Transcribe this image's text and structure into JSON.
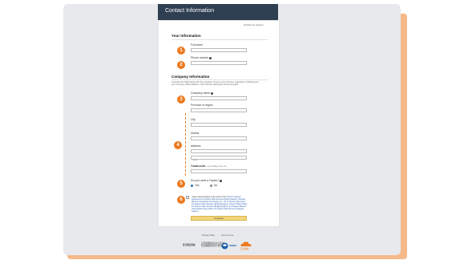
{
  "header": {
    "title": "Contact Information"
  },
  "form": {
    "required_note": "All fields are required",
    "your_info_title": "Your Information",
    "full_name_label": "Full name",
    "phone_label": "Phone number",
    "company_title": "Company Information",
    "company_desc": "Complete the fields below with the company name as your business registration certificate and your company official address. Only Chinese addresses will be accepted.",
    "company_name_label": "Company name",
    "province_label": "Province or region",
    "city_label": "City",
    "district_label": "District",
    "address_label": "Address",
    "address_placeholder": "Street",
    "address2_placeholder": "Apartment, suite, unit, building, floor, etc.",
    "postal_label": "Postal code",
    "fapiao_question": "Do you need a Fapiao?",
    "yes_label": "Yes",
    "no_label": "No",
    "agree_prefix": "I have read and agree to the terms of the",
    "agree_links": "Sinnet Customer Agreement for Amazon Web Services (Beijing Region), Ningxia Western Cloud Data Technology Co., Ltd. Customer Agreement for Amazon Web Services (Ningxia Region), Sinnet Privacy Policy for Amazon Web Services (Beijing Region), and Ningxia Western Cloud Data Privacy Policy for Amazon Web Services (Ningxia Region).",
    "continue_button": "Continue"
  },
  "badges": [
    "1",
    "2",
    "3",
    "4",
    "5",
    "6"
  ],
  "footer": {
    "privacy": "Privacy Policy",
    "terms": "Terms of Use",
    "logo1": "亚马逊云科技",
    "logo2a": "光环新网运营的北京区域",
    "logo2b": "西云数据运营的宁夏区域",
    "logo3": "SINNET",
    "logo4": "西云数据"
  },
  "colors": {
    "accent": "#ec7a1f",
    "header_bg": "#2f3f52",
    "button": "#f2d67a",
    "link": "#2a5db0"
  }
}
